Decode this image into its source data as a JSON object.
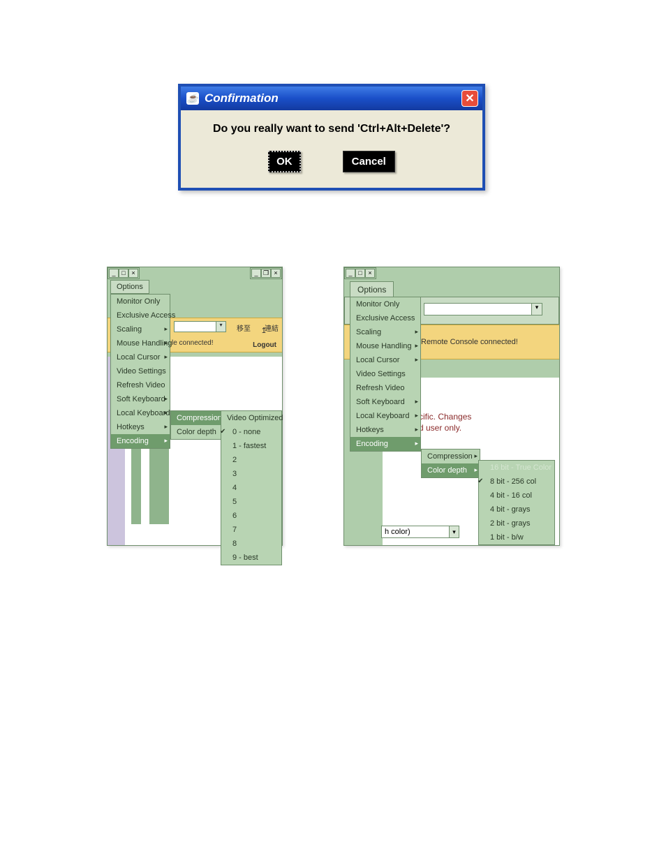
{
  "dialog": {
    "title": "Confirmation",
    "message": "Do you really want to send 'Ctrl+Alt+Delete'?",
    "ok": "OK",
    "cancel": "Cancel"
  },
  "panelLeft": {
    "optionsBtn": "Options",
    "menu": [
      "Monitor Only",
      "Exclusive Access",
      "Scaling",
      "Mouse Handling",
      "Local Cursor",
      "Video Settings",
      "Refresh Video",
      "Soft Keyboard",
      "Local Keyboard",
      "Hotkeys",
      "Encoding"
    ],
    "statusConnected": "le connected!",
    "logout": "Logout",
    "toolbarLink1": "移至",
    "toolbarLink2": "連結",
    "encodingMenu": {
      "compression": "Compression",
      "colorDepth": "Color depth"
    },
    "compressionLevels": {
      "header": "Video Optimized",
      "items": [
        "0 - none",
        "1 - fastest",
        "2",
        "3",
        "4",
        "5",
        "6",
        "7",
        "8",
        "9 - best"
      ],
      "checkedIndex": 0
    }
  },
  "panelRight": {
    "optionsBtn": "Options",
    "menu": [
      "Monitor Only",
      "Exclusive Access",
      "Scaling",
      "Mouse Handling",
      "Local Cursor",
      "Video Settings",
      "Refresh Video",
      "Soft Keyboard",
      "Local Keyboard",
      "Hotkeys",
      "Encoding"
    ],
    "statusConnected": "Remote Console connected!",
    "note1": "cific. Changes",
    "note2": "d user only.",
    "encodingMenu": {
      "compression": "Compression",
      "colorDepth": "Color depth"
    },
    "colorDepths": {
      "items": [
        "16 bit - True Color",
        "8 bit - 256 col",
        "4 bit - 16 col",
        "4 bit - grays",
        "2 bit - grays",
        "1 bit - b/w"
      ],
      "disabledIndex": 0,
      "checkedIndex": 1
    },
    "smallDropdown": "h color)"
  }
}
